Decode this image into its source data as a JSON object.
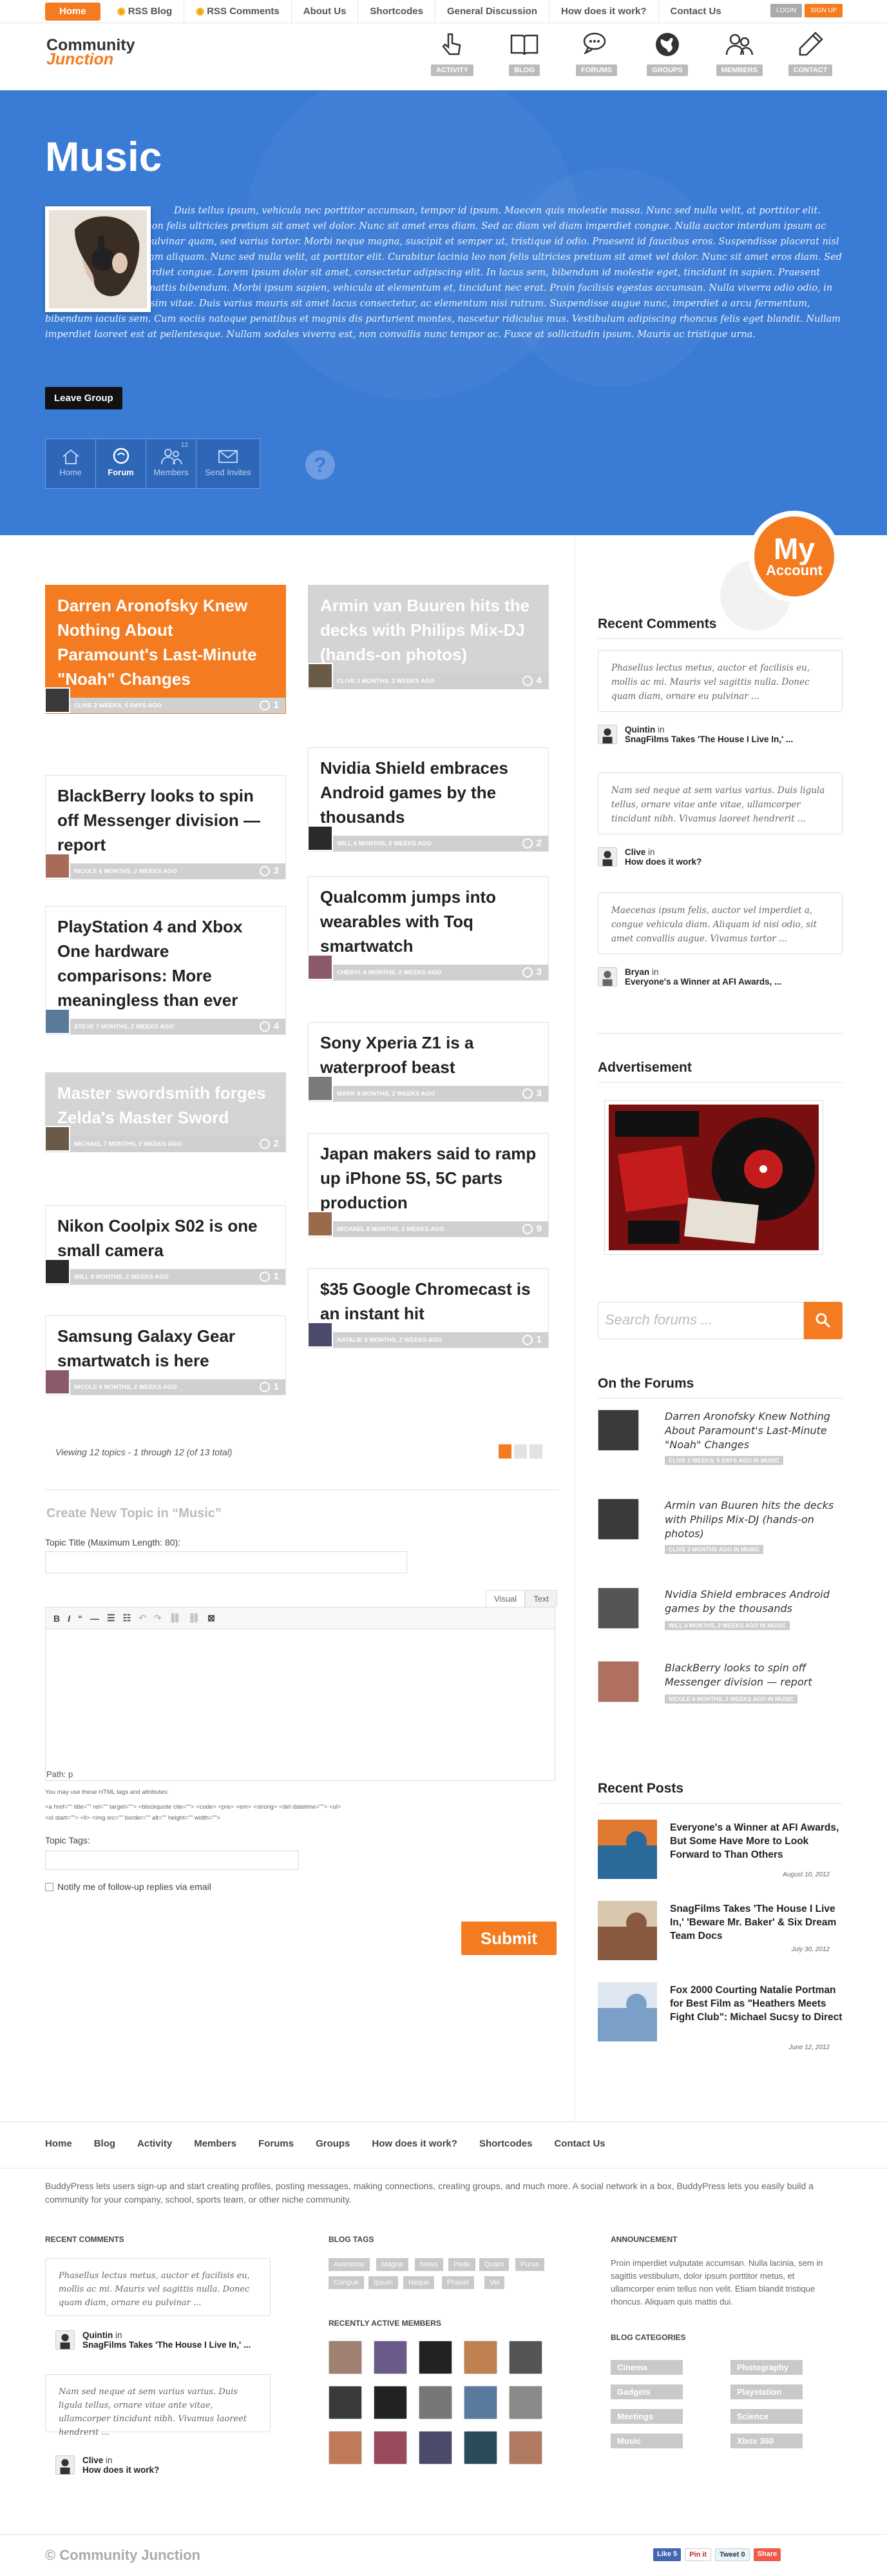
{
  "topnav": {
    "home": "Home",
    "items": [
      "RSS Blog",
      "RSS Comments",
      "About Us",
      "Shortcodes",
      "General Discussion",
      "How does it work?",
      "Contact Us"
    ],
    "login": "LOGIN",
    "signup": "SIGN UP"
  },
  "logo": {
    "line1": "Community",
    "line2": "Junction"
  },
  "header_icons": [
    "ACTIVITY",
    "BLOG",
    "FORUMS",
    "GROUPS",
    "MEMBERS",
    "CONTACT"
  ],
  "group": {
    "title": "Music",
    "description": "Duis tellus ipsum, vehicula nec porttitor accumsan, tempor id ipsum. Maecen quis molestie massa. Nunc sed nulla velit, at porttitor elit. Curabitur lacinia leo non felis ultricies pretium sit amet vel dolor. Nunc sit amet eros diam. Sed ac diam vel diam imperdiet congue. Nulla auctor interdum ipsum ac feugiat. Aenean quis pulvinar quam, sed varius tortor. Morbi neque magna, suscipit et semper ut, tristique id odio. Praesent id faucibus eros. Suspendisse placerat nisl odio, quis faucibus quam aliquam. Nunc sed nulla velit, at porttitor elit. Curabitur lacinia leo non felis ultricies pretium sit amet vel dolor. Nunc sit amet eros diam. Sed ac diam vel diam imperdiet congue. Lorem ipsum dolor sit amet, consectetur adipiscing elit. In lacus sem, bibendum id molestie eget, tincidunt in sapien. Praesent elementum metus ac mattis bibendum. Morbi ipsum sapien, vehicula at elementum et, tincidunt nec erat. Proin facilisis egestas accumsan. Nulla viverra odio odio, in euismod sapien dignissim vitae. Duis varius mauris sit amet lacus consectetur, ac elementum nisi rutrum. Suspendisse augue nunc, imperdiet a arcu fermentum, bibendum iaculis sem. Cum sociis natoque penatibus et magnis dis parturient montes, nascetur ridiculus mus. Vestibulum adipiscing rhoncus felis eget blandit. Nullam imperdiet laoreet est at pellentesque. Nullam sodales viverra est, non convallis nunc tempor ac. Fusce at sollicitudin ipsum. Mauris ac tristique urna.",
    "leave": "Leave Group",
    "tabs": [
      {
        "label": "Home"
      },
      {
        "label": "Forum"
      },
      {
        "label": "Members",
        "count": "12"
      },
      {
        "label": "Send Invites"
      }
    ]
  },
  "my_account": {
    "line1": "My",
    "line2": "Account"
  },
  "topics_left": [
    {
      "title": "Darren Aronofsky Knew Nothing About Paramount's Last-Minute \"Noah\" Changes",
      "meta": "CLIVE 2 WEEKS, 5 DAYS AGO",
      "replies": "1",
      "style": "orange"
    },
    {
      "title": "BlackBerry looks to spin off Messenger division — report",
      "meta": "NICOLE 6 MONTHS, 2 WEEKS AGO",
      "replies": "3",
      "style": "white"
    },
    {
      "title": "PlayStation 4 and Xbox One hardware comparisons: More meaningless than ever",
      "meta": "STEVE 7 MONTHS, 2 WEEKS AGO",
      "replies": "4",
      "style": "white"
    },
    {
      "title": "Master swordsmith forges Zelda's Master Sword",
      "meta": "MICHAEL 7 MONTHS, 2 WEEKS AGO",
      "replies": "2",
      "style": "grey"
    },
    {
      "title": "Nikon Coolpix S02 is one small camera",
      "meta": "WILL 8 MONTHS, 2 WEEKS AGO",
      "replies": "1",
      "style": "white"
    },
    {
      "title": "Samsung Galaxy Gear smartwatch is here",
      "meta": "NICOLE 8 MONTHS, 2 WEEKS AGO",
      "replies": "1",
      "style": "white"
    }
  ],
  "topics_right": [
    {
      "title": "Armin van Buuren hits the decks with Philips Mix-DJ (hands-on photos)",
      "meta": "CLIVE 3 MONTHS, 2 WEEKS AGO",
      "replies": "4",
      "style": "grey"
    },
    {
      "title": "Nvidia Shield embraces Android games by the thousands",
      "meta": "WILL 4 MONTHS, 2 WEEKS AGO",
      "replies": "2",
      "style": "white"
    },
    {
      "title": "Qualcomm jumps into wearables with Toq smartwatch",
      "meta": "CHERYL 6 MONTHS, 2 WEEKS AGO",
      "replies": "3",
      "style": "white"
    },
    {
      "title": "Sony Xperia Z1 is a waterproof beast",
      "meta": "MARK 8 MONTHS, 2 WEEKS AGO",
      "replies": "3",
      "style": "white"
    },
    {
      "title": "Japan makers said to ramp up iPhone 5S, 5C parts production",
      "meta": "MICHAEL 8 MONTHS, 2 WEEKS AGO",
      "replies": "9",
      "style": "white"
    },
    {
      "title": "$35 Google Chromecast is an instant hit",
      "meta": "NATALIE 8 MONTHS, 2 WEEKS AGO",
      "replies": "1",
      "style": "white"
    }
  ],
  "pagination": {
    "text": "Viewing 12 topics - 1 through 12 (of 13 total)"
  },
  "form": {
    "title": "Create New Topic in “Music”",
    "title_label": "Topic Title (Maximum Length: 80):",
    "visual": "Visual",
    "text": "Text",
    "toolbar": [
      "B",
      "I",
      "“",
      "—",
      "☰",
      "☷",
      "↶",
      "↷",
      "⛓",
      "⛓",
      "⊠"
    ],
    "path": "Path: p",
    "allowed_label": "You may use these HTML tags and attributes:",
    "allowed_tags": "<a href=\"\" title=\"\" rel=\"\" target=\"\"> <blockquote cite=\"\"> <code> <pre> <em> <strong> <del datetime=\"\"> <ul> <ol start=\"\"> <li> <img src=\"\" border=\"\" alt=\"\" height=\"\" width=\"\">",
    "tags_label": "Topic Tags:",
    "notify": "Notify me of follow-up replies via email",
    "submit": "Submit"
  },
  "sidebar": {
    "recent_comments_title": "Recent Comments",
    "comments": [
      {
        "text": "Phasellus lectus metus, auctor et facilisis eu, mollis ac mi. Mauris vel sagittis nulla. Donec quam diam, ornare eu pulvinar ...",
        "author": "Quintin",
        "on": "in",
        "post": "SnagFilms Takes 'The House I Live In,' ..."
      },
      {
        "text": "Nam sed neque at sem varius varius. Duis ligula tellus, ornare vitae ante vitae, ullamcorper tincidunt nibh. Vivamus laoreet hendrerit ...",
        "author": "Clive",
        "on": "in",
        "post": "How does it work?"
      },
      {
        "text": "Maecenas ipsum felis, auctor vel imperdiet a, congue vehicula diam. Aliquam id nisi odio, sit amet convallis augue. Vivamus tortor ...",
        "author": "Bryan",
        "on": "in",
        "post": "Everyone's a Winner at AFI Awards, ..."
      }
    ],
    "advertisement_title": "Advertisement",
    "search_placeholder": "Search forums ...",
    "forums_title": "On the Forums",
    "forums": [
      {
        "title": "Darren Aronofsky Knew Nothing About Paramount's Last-Minute \"Noah\" Changes",
        "meta": "CLIVE 2 WEEKS, 5 DAYS AGO IN MUSIC"
      },
      {
        "title": "Armin van Buuren hits the decks with Philips Mix-DJ (hands-on photos)",
        "meta": "CLIVE 3 MONTHS AGO IN MUSIC"
      },
      {
        "title": "Nvidia Shield embraces Android games by the thousands",
        "meta": "WILL 4 MONTHS, 2 WEEKS AGO IN MUSIC"
      },
      {
        "title": "BlackBerry looks to spin off Messenger division — report",
        "meta": "NICOLE 6 MONTHS, 2 WEEKS AGO IN MUSIC"
      }
    ],
    "posts_title": "Recent Posts",
    "posts": [
      {
        "title": "Everyone's a Winner at AFI Awards, But Some Have More to Look Forward to Than Others",
        "date": "August 10, 2012"
      },
      {
        "title": "SnagFilms Takes 'The House I Live In,' 'Beware Mr. Baker' & Six Dream Team Docs",
        "date": "July 30, 2012"
      },
      {
        "title": "Fox 2000 Courting Natalie Portman for Best Film as \"Heathers Meets Fight Club\": Michael Sucsy to Direct",
        "date": "June 12, 2012"
      }
    ]
  },
  "footer": {
    "nav": [
      "Home",
      "Blog",
      "Activity",
      "Members",
      "Forums",
      "Groups",
      "How does it work?",
      "Shortcodes",
      "Contact Us"
    ],
    "description": "BuddyPress lets users sign-up and start creating profiles, posting messages, making connections, creating groups, and much more. A social network in a box, BuddyPress lets you easily build a community for your company, school, sports team, or other niche community.",
    "recent_comments_title": "RECENT COMMENTS",
    "comments": [
      {
        "text": "Phasellus lectus metus, auctor et facilisis eu, mollis ac mi. Mauris vel sagittis nulla. Donec quam diam, ornare eu pulvinar ...",
        "author": "Quintin",
        "on": "in",
        "post": "SnagFilms Takes 'The House I Live In,' ..."
      },
      {
        "text": "Nam sed neque at sem varius varius. Duis ligula tellus, ornare vitae ante vitae, ullamcorper tincidunt nibh. Vivamus laoreet hendrerit ...",
        "author": "Clive",
        "on": "in",
        "post": "How does it work?"
      }
    ],
    "blog_tags_title": "BLOG TAGS",
    "tags": [
      "Awesome",
      "Magna",
      "News",
      "Pede",
      "Quam",
      "Purus",
      "Congue",
      "Ipsum",
      "Neque",
      "Phasel",
      "Vel"
    ],
    "active_members_title": "RECENTLY ACTIVE MEMBERS",
    "announcement_title": "ANNOUNCEMENT",
    "announcement": "Proin imperdiet vulputate accumsan. Nulla lacinia, sem in sagittis vestibulum, dolor ipsum porttitor metus, et ullamcorper enim tellus non velit. Etiam blandit tristique rhoncus. Aliquam quis mattis dui.",
    "blog_categories_title": "BLOG CATEGORIES",
    "categories": [
      "Cinema",
      "Photography",
      "Gadgets",
      "Playstation",
      "Meetings",
      "Science",
      "Music",
      "Xbox 360"
    ],
    "copyright": "© Community Junction",
    "social": [
      "Like 5",
      "Pin it",
      "Tweet 0",
      "Share"
    ]
  }
}
